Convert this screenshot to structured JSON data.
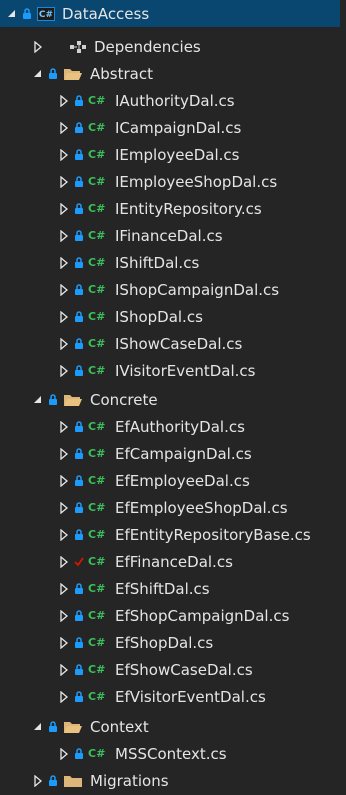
{
  "tree": {
    "project": {
      "name": "DataAccess",
      "icon": "csharp-project-icon"
    },
    "dependencies": {
      "label": "Dependencies",
      "icon": "dependencies-icon"
    },
    "folders": [
      {
        "name": "Abstract",
        "icon": "folder-open-icon",
        "files": [
          "IAuthorityDal.cs",
          "ICampaignDal.cs",
          "IEmployeeDal.cs",
          "IEmployeeShopDal.cs",
          "IEntityRepository.cs",
          "IFinanceDal.cs",
          "IShiftDal.cs",
          "IShopCampaignDal.cs",
          "IShopDal.cs",
          "IShowCaseDal.cs",
          "IVisitorEventDal.cs"
        ]
      },
      {
        "name": "Concrete",
        "icon": "folder-open-icon",
        "files": [
          "EfAuthorityDal.cs",
          "EfCampaignDal.cs",
          "EfEmployeeDal.cs",
          "EfEmployeeShopDal.cs",
          "EfEntityRepositoryBase.cs",
          "EfFinanceDal.cs",
          "EfShiftDal.cs",
          "EfShopCampaignDal.cs",
          "EfShopDal.cs",
          "EfShowCaseDal.cs",
          "EfVisitorEventDal.cs"
        ]
      },
      {
        "name": "Context",
        "icon": "folder-open-icon",
        "files": [
          "MSSContext.cs"
        ]
      },
      {
        "name": "Migrations",
        "icon": "folder-closed-icon",
        "files": []
      }
    ],
    "file_icon_label": "C#",
    "project_icon_label": "C#",
    "colors": {
      "selected_bg": "#094771",
      "csharp_green": "#3ac05a",
      "lock_blue": "#1b9cfc",
      "folder_yellow": "#dcb67a",
      "modified_red": "#e51400"
    },
    "modified_file": "EfFinanceDal.cs"
  }
}
